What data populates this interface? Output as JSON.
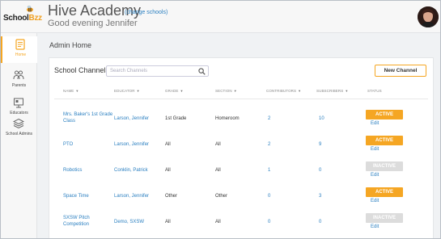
{
  "brand": {
    "logo_text_a": "School",
    "logo_text_b": "Bzz"
  },
  "header": {
    "school_name": "Hive Academy",
    "change_link": "(change schools)",
    "greeting": "Good evening Jennifer"
  },
  "sidebar": {
    "items": [
      {
        "label": "Home",
        "icon": "document-icon"
      },
      {
        "label": "Parents",
        "icon": "parents-icon"
      },
      {
        "label": "Educators",
        "icon": "educators-icon"
      },
      {
        "label": "School Admins",
        "icon": "layers-icon"
      }
    ]
  },
  "main": {
    "title": "Admin Home",
    "card_title": "School Channels",
    "search_placeholder": "Search Channels",
    "new_button": "New Channel",
    "columns": [
      "NAME",
      "EDUCATOR",
      "GRADE",
      "SECTION",
      "CONTRIBUTORS",
      "SUBSCRIBERS",
      "STATUS"
    ],
    "rows": [
      {
        "name": [
          "Mrs. Baker's 1st Grade",
          "Class"
        ],
        "educator": "Larson, Jennifer",
        "grade": "1st Grade",
        "section": "Homeroom",
        "contributors": "2",
        "subscribers": "10",
        "status": "ACTIVE",
        "edit": "Edit"
      },
      {
        "name": [
          "PTO"
        ],
        "educator": "Larson, Jennifer",
        "grade": "All",
        "section": "All",
        "contributors": "2",
        "subscribers": "9",
        "status": "ACTIVE",
        "edit": "Edit"
      },
      {
        "name": [
          "Robotics"
        ],
        "educator": "Conklin, Patrick",
        "grade": "All",
        "section": "All",
        "contributors": "1",
        "subscribers": "0",
        "status": "INACTIVE",
        "edit": "Edit"
      },
      {
        "name": [
          "Space Time"
        ],
        "educator": "Larson, Jennifer",
        "grade": "Other",
        "section": "Other",
        "contributors": "0",
        "subscribers": "3",
        "status": "ACTIVE",
        "edit": "Edit"
      },
      {
        "name": [
          "SXSW Pitch",
          "Competition"
        ],
        "educator": "Demo, SXSW",
        "grade": "All",
        "section": "All",
        "contributors": "0",
        "subscribers": "0",
        "status": "INACTIVE",
        "edit": "Edit"
      }
    ]
  },
  "colors": {
    "accent": "#f5a623",
    "link": "#2a7fc0",
    "inactive": "#dcdcdc"
  }
}
